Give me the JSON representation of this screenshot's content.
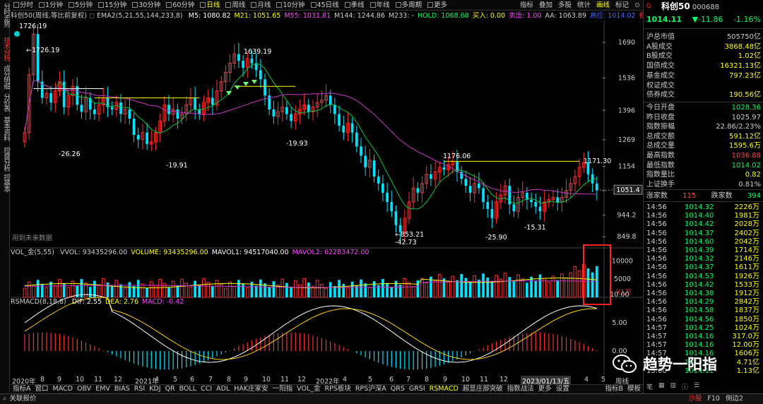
{
  "left_tabs": [
    "分时走势",
    "技术分析",
    "成分明细",
    "分价表",
    "基本资料",
    "控盘分析",
    "控基本"
  ],
  "active_left_tab": 1,
  "topbar": {
    "items": [
      "分时",
      "1分钟",
      "5分钟",
      "15分钟",
      "30分钟",
      "60分钟",
      "日线",
      "周线",
      "月线",
      "10分钟",
      "45日线",
      "季线",
      "年线",
      "多周期",
      "更多"
    ],
    "active": 6,
    "right_items": [
      "指标",
      "叠加",
      "多股",
      "统计",
      "画线",
      "标记"
    ],
    "right_active": 4
  },
  "chart_title": "科创50(周线,等比前复权)",
  "ema_label": "EMA2(5,21,55,144,233,8)",
  "ma_values": [
    {
      "text": "M5: 1080.82",
      "color": "#ffffff"
    },
    {
      "text": "M21: 1051.65",
      "color": "#ffff00"
    },
    {
      "text": "M55: 1031.81",
      "color": "#ff44ff"
    },
    {
      "text": "M144: 1244.86",
      "color": "#cccccc"
    },
    {
      "text": "M233: -",
      "color": "#cccccc"
    },
    {
      "text": "HOLD: 1068.68",
      "color": "#00ff66"
    },
    {
      "text": "买入: 0.00",
      "color": "#ffff00"
    },
    {
      "text": "卖出: 1.00",
      "color": "#ff44ff"
    },
    {
      "text": "AA: 1063.89",
      "color": "#cccccc"
    },
    {
      "text": "高位: 1014.02",
      "color": "#4466ff"
    },
    {
      "text": "低价: -",
      "color": "#ff4444"
    },
    {
      "text": "峰值: 1",
      "color": "#ffff00"
    }
  ],
  "price_labels": {
    "top": "1726.19",
    "p1726": "1726.19",
    "p1639": "1639.19",
    "m2626": "-26.26",
    "m1991": "-19.91",
    "m1993": "-19.93",
    "p1176": "1176.06",
    "p1171": "1171.30",
    "p853": "853.21",
    "m4273": "-42.73",
    "m2590": "-25.90",
    "m1531": "-15.31"
  },
  "y_axis": [
    "1690",
    "1536",
    "1396",
    "1269",
    "1154",
    "1049",
    "944.2",
    "849.8"
  ],
  "current_price_tag": "1051.4",
  "note_text": "用到未来数据",
  "volume": {
    "label": "VOL_金(5,55)",
    "items": [
      {
        "text": "VVOL: 93435296.00",
        "color": "#cccccc"
      },
      {
        "text": "VOLUME: 93435296.00",
        "color": "#ffff00"
      },
      {
        "text": "MAVOL1: 94517040.00",
        "color": "#ffffff"
      },
      {
        "text": "MAVOL2: 62283472.00",
        "color": "#ff44ff"
      }
    ],
    "axis": [
      "10000",
      "5000"
    ],
    "unit": "X1万"
  },
  "macd": {
    "label": "RSMACD(8,18,8)",
    "items": [
      {
        "text": "DIF: 2.55",
        "color": "#ffffff"
      },
      {
        "text": "DEA: 2.76",
        "color": "#ffff00"
      },
      {
        "text": "MACD: -0.42",
        "color": "#ff44ff"
      }
    ],
    "axis": [
      "10.00",
      "5.00",
      "0.00"
    ]
  },
  "x_axis": [
    "2020年",
    "8",
    "9",
    "10",
    "11",
    "12",
    "2021年",
    "4",
    "5",
    "6",
    "7",
    "8",
    "9",
    "10",
    "11",
    "12",
    "2022年",
    "4",
    "5",
    "6",
    "7",
    "8",
    "9",
    "10",
    "11",
    "12",
    "2023/01/13/五",
    "4",
    "5"
  ],
  "x_axis_right": "周线",
  "bottom_tabs": [
    "指标A",
    "窗口",
    "MACD",
    "OBV",
    "EMV",
    "BIAS",
    "RSI",
    "KDJ",
    "QR",
    "BOLL",
    "CCI",
    "ADL",
    "HAK庄家安",
    "一阳指",
    "VOL_金",
    "RPS板块",
    "RPS沪深A",
    "QRS",
    "GRSI",
    "RSMACD",
    "超显庄部突破",
    "指数战法",
    "更多",
    "设置"
  ],
  "bottom_active": 19,
  "bottom_right": [
    "指标B",
    "模板"
  ],
  "status": {
    "left": "关联报价",
    "right": [
      "沙股",
      "F10",
      "侧边2"
    ]
  },
  "stock": {
    "name": "科创50",
    "code": "000688",
    "price": "1014.11",
    "change": "▼-11.86",
    "pct": "-1.16%"
  },
  "stats": [
    {
      "label": "沪总市值",
      "value": "505750亿",
      "color": "#cccccc"
    },
    {
      "label": "A股成交",
      "value": "3868.48亿",
      "color": "#ffff00"
    },
    {
      "label": "B股成交",
      "value": "1.02亿",
      "color": "#ffff00"
    },
    {
      "label": "国债成交",
      "value": "16321.13亿",
      "color": "#ffff00"
    },
    {
      "label": "基金成交",
      "value": "797.23亿",
      "color": "#ffff00"
    },
    {
      "label": "权证成交",
      "value": "",
      "color": "#ffff00"
    },
    {
      "label": "债券成交",
      "value": "190.56亿",
      "color": "#ffff00"
    }
  ],
  "stats2": [
    {
      "label": "今日开盘",
      "value": "1028.36",
      "color": "#00ff66"
    },
    {
      "label": "昨日收盘",
      "value": "1025.97",
      "color": "#cccccc"
    },
    {
      "label": "指数振幅",
      "value": "22.86/2.23%",
      "color": "#cccccc"
    },
    {
      "label": "总成交额",
      "value": "591.12亿",
      "color": "#ffff00"
    },
    {
      "label": "总成交量",
      "value": "1595.6万",
      "color": "#ffff00"
    },
    {
      "label": "最高指数",
      "value": "1036.88",
      "color": "#ff4444"
    },
    {
      "label": "最低指数",
      "value": "1014.02",
      "color": "#00ff66"
    },
    {
      "label": "指数量比",
      "value": "0.82",
      "color": "#ffff00"
    },
    {
      "label": "上证换手",
      "value": "0.81%",
      "color": "#cccccc"
    }
  ],
  "updown": {
    "up_label": "涨家数",
    "up": "115",
    "down_label": "跌家数",
    "down": "394"
  },
  "ticks": [
    {
      "time": "14:56",
      "price": "1014.32",
      "vol": "2226万"
    },
    {
      "time": "14:56",
      "price": "1014.40",
      "vol": "1981万"
    },
    {
      "time": "14:56",
      "price": "1014.42",
      "vol": "2028万"
    },
    {
      "time": "14:56",
      "price": "1014.37",
      "vol": "2402万"
    },
    {
      "time": "14:56",
      "price": "1014.60",
      "vol": "2042万"
    },
    {
      "time": "14:56",
      "price": "1014.39",
      "vol": "1714万"
    },
    {
      "time": "14:56",
      "price": "1014.32",
      "vol": "2146万"
    },
    {
      "time": "14:56",
      "price": "1014.37",
      "vol": "1611万"
    },
    {
      "time": "14:56",
      "price": "1014.53",
      "vol": "1926万"
    },
    {
      "time": "14:56",
      "price": "1014.42",
      "vol": "1533万"
    },
    {
      "time": "14:56",
      "price": "1014.38",
      "vol": "1912万"
    },
    {
      "time": "14:56",
      "price": "1014.29",
      "vol": "2842万"
    },
    {
      "time": "14:56",
      "price": "1014.58",
      "vol": "1837万"
    },
    {
      "time": "14:56",
      "price": "1014.56",
      "vol": "1850万"
    },
    {
      "time": "14:57",
      "price": "1014.25",
      "vol": "1024万"
    },
    {
      "time": "14:57",
      "price": "1014.16",
      "vol": "317.0万"
    },
    {
      "time": "14:57",
      "price": "1014.16",
      "vol": "12.00万"
    },
    {
      "time": "14:57",
      "price": "1014.16",
      "vol": "1606万"
    },
    {
      "time": "14:57",
      "price": "1014.16",
      "vol": "4.71亿"
    },
    {
      "time": "15:00",
      "price": "1014.11",
      "vol": "1.13亿"
    }
  ],
  "watermark": "趋势一阳指",
  "chart_data": {
    "type": "candlestick",
    "title": "科创50(周线,等比前复权)",
    "y_ticks": [
      1690,
      1536,
      1396,
      1269,
      1154,
      1049,
      944.2,
      849.8
    ],
    "ylim": [
      820,
      1760
    ],
    "annotations": {
      "high": 1726.19,
      "peak2": 1639.19,
      "low": 853.21,
      "resistance": 1176.06,
      "recent_high": 1171.3
    },
    "volume_axis": [
      10000,
      5000
    ],
    "macd_axis": [
      10.0,
      5.0,
      0.0
    ],
    "close_path": [
      1300,
      1550,
      1726,
      1520,
      1450,
      1470,
      1430,
      1480,
      1520,
      1410,
      1460,
      1500,
      1420,
      1390,
      1450,
      1400,
      1380,
      1420,
      1450,
      1410,
      1400,
      1430,
      1380,
      1400,
      1360,
      1290,
      1270,
      1300,
      1250,
      1260,
      1300,
      1350,
      1420,
      1380,
      1400,
      1360,
      1380,
      1420,
      1450,
      1400,
      1380,
      1430,
      1450,
      1420,
      1480,
      1520,
      1560,
      1600,
      1639,
      1610,
      1580,
      1620,
      1600,
      1570,
      1530,
      1460,
      1400,
      1370,
      1390,
      1410,
      1380,
      1350,
      1380,
      1400,
      1420,
      1390,
      1410,
      1430,
      1440,
      1460,
      1420,
      1380,
      1330,
      1300,
      1340,
      1300,
      1240,
      1200,
      1150,
      1180,
      1110,
      1080,
      1040,
      1000,
      960,
      900,
      870,
      930,
      1000,
      1060,
      1040,
      1080,
      1120,
      1100,
      1130,
      1150,
      1140,
      1160,
      1176,
      1130,
      1100,
      1070,
      1040,
      1080,
      1060,
      1000,
      970,
      930,
      1000,
      1030,
      1070,
      990,
      960,
      1020,
      1040,
      1010,
      1000,
      980,
      960,
      1000,
      1010,
      1020,
      1000,
      1020,
      1050,
      1080,
      1110,
      1150,
      1171,
      1120,
      1080,
      1050
    ]
  }
}
